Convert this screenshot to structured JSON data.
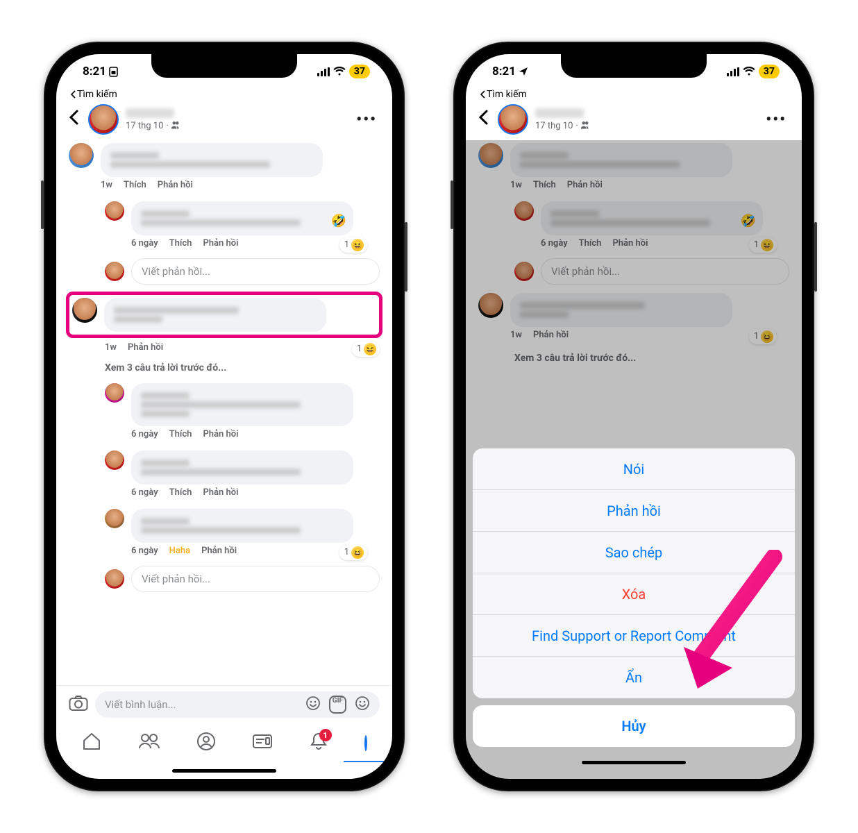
{
  "status": {
    "time": "8:21",
    "breadcrumb": "Tìm kiếm",
    "battery": "37"
  },
  "post": {
    "date": "17 thg 10"
  },
  "labels": {
    "like": "Thích",
    "reply": "Phản hồi",
    "haha": "Haha",
    "time_1w": "1w",
    "time_6d": "6 ngày",
    "reply_placeholder": "Viết phản hồi...",
    "view_prev": "Xem 3 câu trả lời trước đó...",
    "comment_placeholder": "Viết bình luận...",
    "gif": "GIF",
    "react_count": "1",
    "notif_badge": "1"
  },
  "sheet": {
    "speak": "Nói",
    "reply": "Phản hồi",
    "copy": "Sao chép",
    "delete": "Xóa",
    "report": "Find Support or Report Comment",
    "hide": "Ẩn",
    "cancel": "Hủy"
  }
}
